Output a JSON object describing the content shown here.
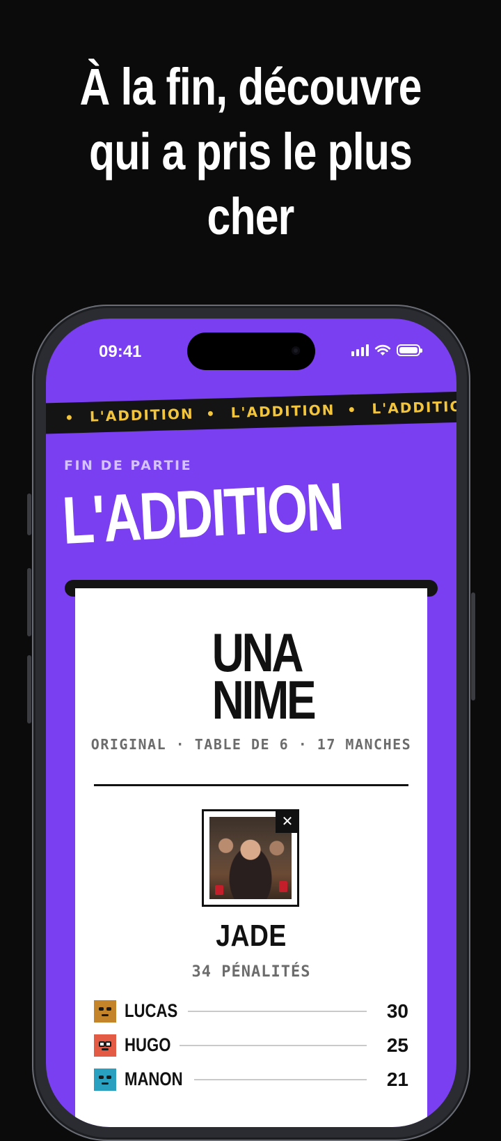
{
  "headline": {
    "lines": [
      "À la fin, découvre",
      "qui a pris le plus",
      "cher"
    ]
  },
  "status_bar": {
    "time": "09:41",
    "icons": [
      "signal-icon",
      "wifi-icon",
      "battery-icon"
    ]
  },
  "ticker": {
    "text": "L'ADDITION"
  },
  "screen": {
    "eyebrow": "FIN DE PARTIE",
    "title": "L'ADDITION"
  },
  "receipt": {
    "logo_line1": "UNA",
    "logo_line2": "NIME",
    "meta": "ORIGINAL · TABLE DE 6 · 17 MANCHES",
    "close_symbol": "✕",
    "winner_name": "JADE",
    "winner_penalties": "34 PÉNALITÉS",
    "players": [
      {
        "name": "LUCAS",
        "score": "30",
        "color": "#c4842a"
      },
      {
        "name": "HUGO",
        "score": "25",
        "color": "#e35a45"
      },
      {
        "name": "MANON",
        "score": "21",
        "color": "#2aa0c0"
      }
    ]
  },
  "colors": {
    "background": "#0b0b0b",
    "screen_purple": "#7a3ff0",
    "ticker_text": "#f2c53d"
  }
}
